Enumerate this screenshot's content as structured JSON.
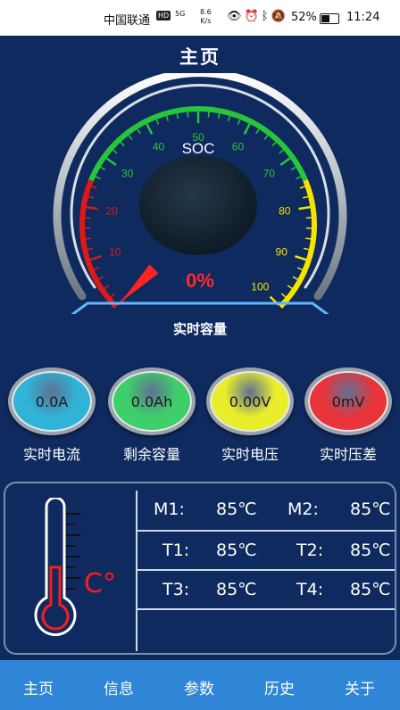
{
  "status_bar": {
    "carrier": "中国联通",
    "hd_badge": "HD",
    "signal": "5G",
    "speed_value": "8.6",
    "speed_unit": "K/s",
    "battery_percent": "52%",
    "time": "11:24"
  },
  "page": {
    "title": "主页"
  },
  "gauge": {
    "label": "SOC",
    "value_text": "0%",
    "value": 0,
    "ticks": [
      "10",
      "20",
      "30",
      "40",
      "50",
      "60",
      "70",
      "80",
      "90",
      "100"
    ],
    "colors": {
      "red": "#e01818",
      "green": "#27c63a",
      "yellow": "#f5e300",
      "value": "#ff2a2a"
    }
  },
  "capacity_label": "实时容量",
  "metrics": [
    {
      "value": "0.0A",
      "label": "实时电流",
      "color": "#2fb3d6"
    },
    {
      "value": "0.0Ah",
      "label": "剩余容量",
      "color": "#3fcf6a"
    },
    {
      "value": "0.00V",
      "label": "实时电压",
      "color": "#e8ef2a"
    },
    {
      "value": "0mV",
      "label": "实时压差",
      "color": "#e8343a"
    }
  ],
  "temperatures": {
    "unit_symbol": "C°",
    "rows": [
      [
        {
          "label": "M1:",
          "value": "85℃"
        },
        {
          "label": "M2:",
          "value": "85℃"
        }
      ],
      [
        {
          "label": "T1:",
          "value": "85℃"
        },
        {
          "label": "T2:",
          "value": "85℃"
        }
      ],
      [
        {
          "label": "T3:",
          "value": "85℃"
        },
        {
          "label": "T4:",
          "value": "85℃"
        }
      ]
    ]
  },
  "nav": {
    "items": [
      "主页",
      "信息",
      "参数",
      "历史",
      "关于"
    ]
  }
}
